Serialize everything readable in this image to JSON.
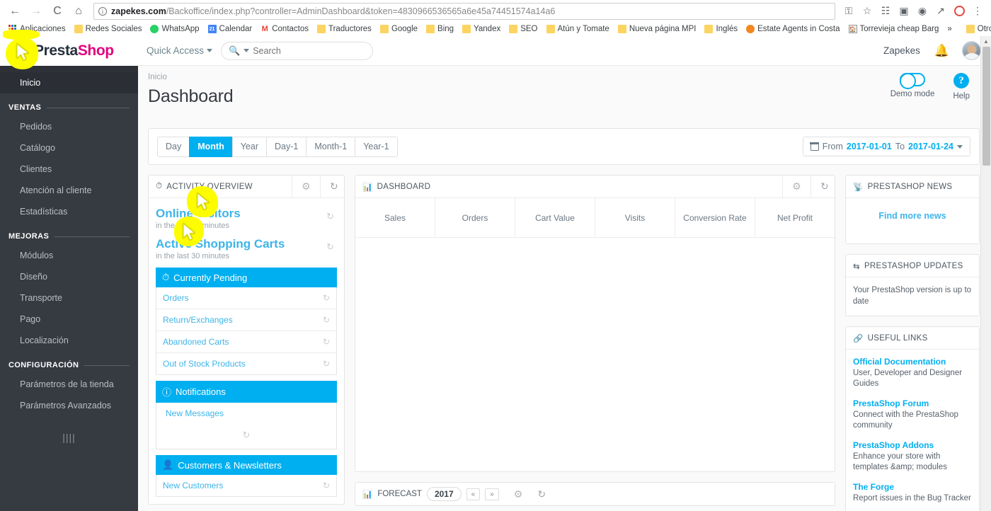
{
  "browser": {
    "url_host": "zapekes.com",
    "url_path": "/Backoffice/index.php?controller=AdminDashboard&token=4830966536565a6e45a74451574a14a6",
    "back_icon": "back-arrow-icon",
    "forward_icon": "forward-arrow-icon",
    "reload_icon": "reload-icon",
    "home_icon": "home-icon",
    "info_icon": "info-icon",
    "bookmark_star_icon": "star-icon",
    "menu_icon": "kebab-menu-icon",
    "bookmarks": [
      {
        "label": "Aplicaciones",
        "icon": "apps-grid-icon"
      },
      {
        "label": "Redes Sociales",
        "icon": "folder-icon"
      },
      {
        "label": "WhatsApp",
        "icon": "whatsapp-icon"
      },
      {
        "label": "Calendar",
        "icon": "calendar-icon"
      },
      {
        "label": "Contactos",
        "icon": "gmail-icon"
      },
      {
        "label": "Traductores",
        "icon": "folder-icon"
      },
      {
        "label": "Google",
        "icon": "folder-icon"
      },
      {
        "label": "Bing",
        "icon": "folder-icon"
      },
      {
        "label": "Yandex",
        "icon": "folder-icon"
      },
      {
        "label": "SEO",
        "icon": "folder-icon"
      },
      {
        "label": "Atún y Tomate",
        "icon": "folder-icon"
      },
      {
        "label": "Nueva página MPI",
        "icon": "folder-icon"
      },
      {
        "label": "Inglés",
        "icon": "folder-icon"
      },
      {
        "label": "Estate Agents in Costa",
        "icon": "orange-dot-icon"
      },
      {
        "label": "Torrevieja cheap Barg",
        "icon": "house-icon"
      }
    ],
    "overflow_label": "»",
    "other_bookmarks": "Otros marcadores"
  },
  "sidebar": {
    "brand_pre": "Presta",
    "brand_shop": "Shop",
    "home_item": "Inicio",
    "sections": [
      {
        "label": "VENTAS",
        "items": [
          "Pedidos",
          "Catálogo",
          "Clientes",
          "Atención al cliente",
          "Estadísticas"
        ]
      },
      {
        "label": "MEJORAS",
        "items": [
          "Módulos",
          "Diseño",
          "Transporte",
          "Pago",
          "Localización"
        ]
      },
      {
        "label": "CONFIGURACIÓN",
        "items": [
          "Parámetros de la tienda",
          "Parámetros Avanzados"
        ]
      }
    ],
    "collapse_handle": "||||"
  },
  "topbar": {
    "quick_access": "Quick Access",
    "search_placeholder": "Search",
    "search_value": "",
    "user_name": "Zapekes",
    "bell_icon": "bell-icon",
    "avatar_icon": "user-avatar"
  },
  "header": {
    "breadcrumb": "Inicio",
    "title": "Dashboard",
    "demo_mode_label": "Demo mode",
    "help_label": "Help",
    "help_glyph": "?"
  },
  "toolbar": {
    "range_buttons": [
      "Day",
      "Month",
      "Year",
      "Day-1",
      "Month-1",
      "Year-1"
    ],
    "active_range": "Month",
    "date_from_label": "From",
    "date_from": "2017-01-01",
    "date_to_label": "To",
    "date_to": "2017-01-24"
  },
  "activity_overview": {
    "title": "ACTIVITY OVERVIEW",
    "clock_icon": "clock-icon",
    "gear_icon": "gear-icon",
    "refresh_icon": "refresh-icon",
    "stats": [
      {
        "title": "Online Visitors",
        "sub": "in the last 30 minutes"
      },
      {
        "title": "Active Shopping Carts",
        "sub": "in the last 30 minutes"
      }
    ],
    "sections": [
      {
        "label": "Currently Pending",
        "icon": "clock-icon",
        "rows": [
          "Orders",
          "Return/Exchanges",
          "Abandoned Carts",
          "Out of Stock Products"
        ]
      },
      {
        "label": "Notifications",
        "icon": "info-icon",
        "rows": [
          "New Messages"
        ]
      },
      {
        "label": "Customers & Newsletters",
        "icon": "user-icon",
        "rows": [
          "New Customers"
        ]
      }
    ]
  },
  "dashboard_panel": {
    "title": "DASHBOARD",
    "chart_icon": "bar-chart-icon",
    "gear_icon": "gear-icon",
    "refresh_icon": "refresh-icon",
    "columns": [
      "Sales",
      "Orders",
      "Cart Value",
      "Visits",
      "Conversion Rate",
      "Net Profit"
    ],
    "values": [
      "",
      "",
      "",
      "",
      "",
      ""
    ]
  },
  "forecast_panel": {
    "title": "FORECAST",
    "chart_icon": "bar-chart-icon",
    "year": "2017",
    "prev_label": "«",
    "next_label": "»",
    "gear_icon": "gear-icon",
    "refresh_icon": "refresh-icon"
  },
  "right_panels": {
    "news": {
      "title": "PRESTASHOP NEWS",
      "rss_icon": "rss-icon",
      "link": "Find more news"
    },
    "updates": {
      "title": "PRESTASHOP UPDATES",
      "sync_icon": "sync-icon",
      "text": "Your PrestaShop version is up to date"
    },
    "useful_links": {
      "title": "USEFUL LINKS",
      "link_icon": "link-icon",
      "items": [
        {
          "title": "Official Documentation",
          "desc": "User, Developer and Designer Guides"
        },
        {
          "title": "PrestaShop Forum",
          "desc": "Connect with the PrestaShop community"
        },
        {
          "title": "PrestaShop Addons",
          "desc": "Enhance your store with templates &amp; modules"
        },
        {
          "title": "The Forge",
          "desc": "Report issues in the Bug Tracker"
        }
      ]
    }
  },
  "annotations": {
    "highlight_color": "#fdfd00",
    "count": 4
  },
  "colors": {
    "accent": "#00aff0",
    "sidebar_bg": "#363a41",
    "brand_pink": "#e4007f",
    "link_blue": "#3eb4e9",
    "page_bg": "#fafafa"
  }
}
